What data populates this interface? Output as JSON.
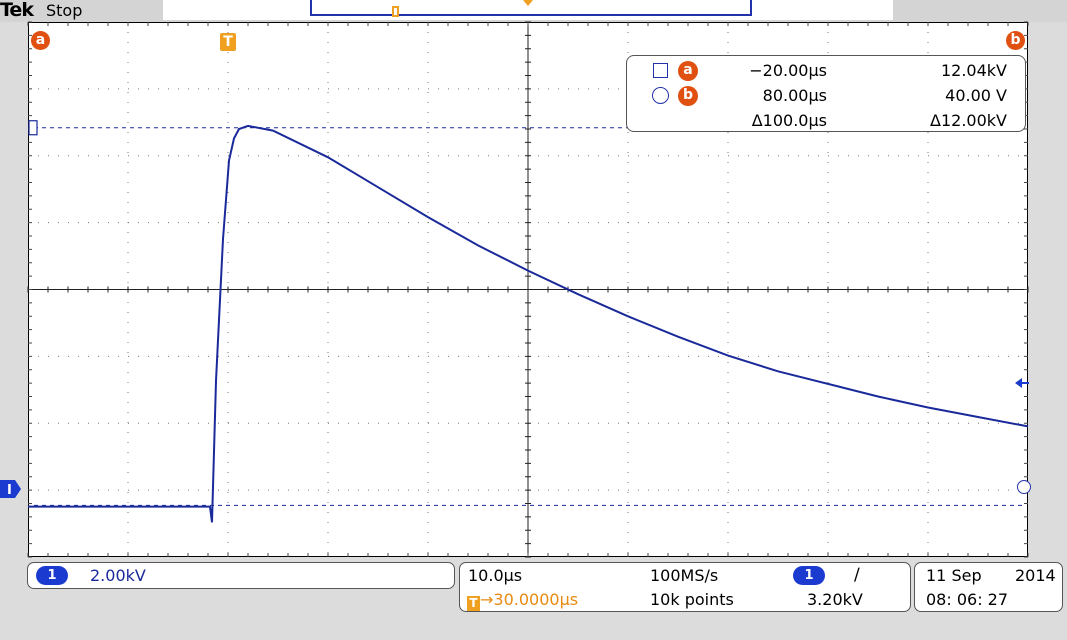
{
  "header": {
    "brand": "Tek",
    "acquisition_state": "Stop",
    "trigger_icon": "trigger-position-icon",
    "record_marker_icon": "record-trigger-icon"
  },
  "cursors": {
    "a_label": "a",
    "b_label": "b",
    "trigger_label": "T"
  },
  "readout": {
    "row_a": {
      "marker": "a",
      "icon": "square-cursor-icon",
      "time": "−20.00μs",
      "value": "12.04kV"
    },
    "row_b": {
      "marker": "b",
      "icon": "circle-cursor-icon",
      "time": "80.00μs",
      "value": "40.00 V"
    },
    "delta": {
      "time": "Δ100.0μs",
      "value": "Δ12.00kV"
    }
  },
  "channel": {
    "number": "1",
    "scale": "2.00kV",
    "color": "#1a3ad0"
  },
  "timebase": {
    "scale": "10.0μs",
    "sample_rate": "100MS/s",
    "position": "→30.0000μs",
    "record_length": "10k points"
  },
  "trigger": {
    "channel": "1",
    "slope_icon": "rising-edge-icon",
    "slope_glyph": "∕",
    "level": "3.20kV"
  },
  "datetime": {
    "date_day_month": "11 Sep",
    "year": "2014",
    "time": "08: 06: 27"
  },
  "colors": {
    "trace": "#1a2a9a",
    "cursor_marker": "#e05010",
    "trigger": "#f0a020"
  },
  "chart_data": {
    "type": "line",
    "x_unit": "μs",
    "y_unit": "kV",
    "x_range": [
      -50,
      50
    ],
    "y_range": [
      -1.6,
      15.4
    ],
    "grid": true,
    "series": [
      {
        "values_x": [
          -50,
          -40,
          -31.8,
          -31.6,
          -31.2,
          -30.5,
          -29.9,
          -29.4,
          -28.9,
          -28.0,
          -25.5,
          -20.0,
          -15.0,
          -10.0,
          -5.0,
          0.0,
          5.0,
          10.0,
          15.0,
          20.0,
          25.0,
          30.0,
          35.0,
          40.0,
          45.0,
          50.0
        ],
        "values_y": [
          0.0,
          0.0,
          0.0,
          -0.5,
          4.0,
          8.5,
          11.0,
          11.7,
          12.0,
          12.1,
          11.95,
          11.1,
          10.15,
          9.2,
          8.3,
          7.5,
          6.75,
          6.05,
          5.4,
          4.8,
          4.3,
          3.9,
          3.5,
          3.15,
          2.85,
          2.55
        ]
      }
    ]
  }
}
